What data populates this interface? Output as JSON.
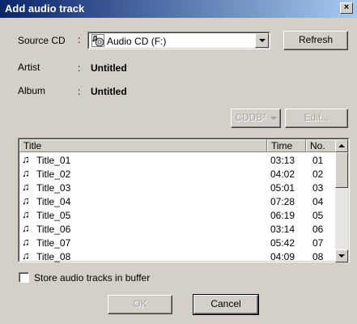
{
  "window": {
    "title": "Add audio track",
    "close_glyph": "×"
  },
  "source": {
    "label": "Source CD",
    "colon": ":",
    "selected": "Audio CD (F:)",
    "icon": "audio-cd-icon"
  },
  "artist": {
    "label": "Artist",
    "colon": ":",
    "value": "Untitled"
  },
  "album": {
    "label": "Album",
    "colon": ":",
    "value": "Untitled"
  },
  "buttons": {
    "refresh": "Refresh",
    "cddb": "CDDB²",
    "edit": "Edit...",
    "ok": "OK",
    "cancel": "Cancel"
  },
  "tracks": {
    "columns": [
      "Title",
      "Time",
      "No."
    ],
    "rows": [
      {
        "title": "Title_01",
        "time": "03:13",
        "no": "01"
      },
      {
        "title": "Title_02",
        "time": "04:02",
        "no": "02"
      },
      {
        "title": "Title_03",
        "time": "05:01",
        "no": "03"
      },
      {
        "title": "Title_04",
        "time": "07:28",
        "no": "04"
      },
      {
        "title": "Title_05",
        "time": "06:19",
        "no": "05"
      },
      {
        "title": "Title_06",
        "time": "03:14",
        "no": "06"
      },
      {
        "title": "Title_07",
        "time": "05:42",
        "no": "07"
      },
      {
        "title": "Title_08",
        "time": "04:09",
        "no": "08"
      }
    ],
    "track_icon": "music-note-icon",
    "note_glyph": "♫"
  },
  "store_buffer": {
    "label": "Store audio tracks in buffer",
    "checked": false
  },
  "colors": {
    "face": "#d4d0c8",
    "titlebar_start": "#0a246a",
    "titlebar_end": "#a6caf0"
  }
}
